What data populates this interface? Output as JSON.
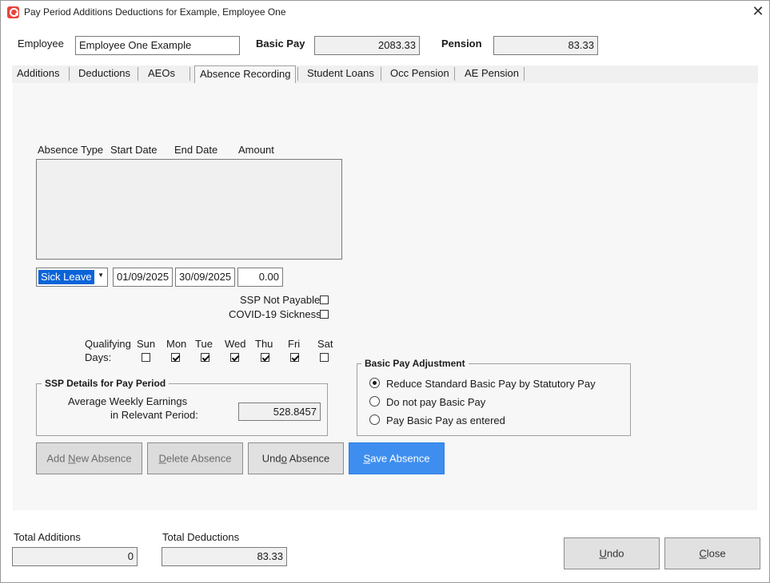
{
  "window": {
    "title": "Pay Period Additions Deductions for Example, Employee One",
    "close_glyph": "✕"
  },
  "header": {
    "employee_label": "Employee",
    "employee_value": "Employee One Example",
    "basic_pay_label": "Basic Pay",
    "basic_pay_value": "2083.33",
    "pension_label": "Pension",
    "pension_value": "83.33"
  },
  "tabs": {
    "additions": "Additions",
    "deductions": "Deductions",
    "aeos": "AEOs",
    "absence_recording": "Absence Recording",
    "student_loans": "Student Loans",
    "occ_pension": "Occ Pension",
    "ae_pension": "AE Pension",
    "active": "Absence Recording"
  },
  "absence": {
    "columns": [
      "Absence Type",
      "Start Date",
      "End Date",
      "Amount"
    ],
    "rows": [],
    "type_selected": "Sick Leave",
    "start_date": "01/09/2025",
    "end_date": "30/09/2025",
    "amount": "0.00",
    "ssp_not_payable_label": "SSP Not Payable",
    "ssp_not_payable_checked": false,
    "covid_label": "COVID-19 Sickness",
    "covid_checked": false
  },
  "qualifying_days": {
    "label_line1": "Qualifying",
    "label_line2": "Days:",
    "days": [
      {
        "label": "Sun",
        "checked": false
      },
      {
        "label": "Mon",
        "checked": true
      },
      {
        "label": "Tue",
        "checked": true
      },
      {
        "label": "Wed",
        "checked": true
      },
      {
        "label": "Thu",
        "checked": true
      },
      {
        "label": "Fri",
        "checked": true
      },
      {
        "label": "Sat",
        "checked": false
      }
    ]
  },
  "ssp_details": {
    "title": "SSP Details for Pay Period",
    "awe_label_line1": "Average Weekly Earnings",
    "awe_label_line2": "in Relevant Period:",
    "awe_value": "528.8457"
  },
  "basic_pay_adjustment": {
    "title": "Basic Pay Adjustment",
    "options": [
      {
        "label": "Reduce Standard Basic Pay by Statutory Pay",
        "selected": true
      },
      {
        "label": "Do not pay Basic Pay",
        "selected": false
      },
      {
        "label": "Pay Basic Pay as entered",
        "selected": false
      }
    ]
  },
  "buttons": {
    "add_new_absence": {
      "pre": "Add ",
      "mn": "N",
      "post": "ew Absence"
    },
    "delete_absence": {
      "pre": "",
      "mn": "D",
      "post": "elete Absence"
    },
    "undo_absence": {
      "pre": "Und",
      "mn": "o",
      "post": " Absence"
    },
    "save_absence": {
      "pre": "",
      "mn": "S",
      "post": "ave Absence"
    },
    "undo": {
      "pre": "",
      "mn": "U",
      "post": "ndo"
    },
    "close": {
      "pre": "",
      "mn": "C",
      "post": "lose"
    }
  },
  "totals": {
    "additions_label": "Total Additions",
    "additions_value": "0",
    "deductions_label": "Total Deductions",
    "deductions_value": "83.33"
  },
  "colors": {
    "accent": "#3e8ef0",
    "selection": "#0a64d8",
    "app_icon": "#e8453c"
  }
}
